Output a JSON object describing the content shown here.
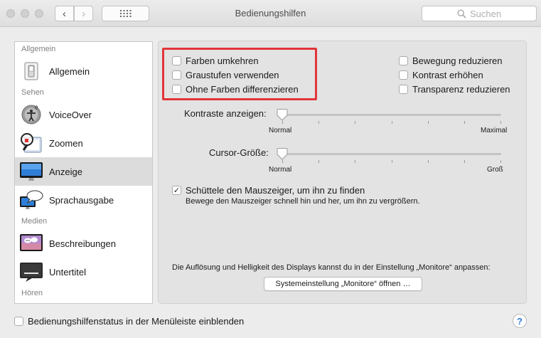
{
  "window": {
    "title": "Bedienungshilfen",
    "back_glyph": "‹",
    "forward_glyph": "›",
    "search_placeholder": "Suchen"
  },
  "sidebar": {
    "sections": [
      {
        "header": "Allgemein",
        "items": [
          {
            "label": "Allgemein",
            "icon": "switch-icon"
          }
        ]
      },
      {
        "header": "Sehen",
        "items": [
          {
            "label": "VoiceOver",
            "icon": "voiceover-icon"
          },
          {
            "label": "Zoomen",
            "icon": "zoom-icon"
          },
          {
            "label": "Anzeige",
            "icon": "display-icon",
            "selected": true
          },
          {
            "label": "Sprachausgabe",
            "icon": "speech-icon"
          }
        ]
      },
      {
        "header": "Medien",
        "items": [
          {
            "label": "Beschreibungen",
            "icon": "descriptions-icon"
          },
          {
            "label": "Untertitel",
            "icon": "captions-icon"
          }
        ]
      },
      {
        "header": "Hören",
        "items": []
      }
    ]
  },
  "display": {
    "checkboxes_left": [
      {
        "label": "Farben umkehren",
        "checked": false
      },
      {
        "label": "Graustufen verwenden",
        "checked": false
      },
      {
        "label": "Ohne Farben differenzieren",
        "checked": false
      }
    ],
    "checkboxes_right": [
      {
        "label": "Bewegung reduzieren",
        "checked": false
      },
      {
        "label": "Kontrast erhöhen",
        "checked": false
      },
      {
        "label": "Transparenz reduzieren",
        "checked": false
      }
    ],
    "contrast": {
      "label": "Kontraste anzeigen:",
      "min_label": "Normal",
      "max_label": "Maximal",
      "value": 0
    },
    "cursor": {
      "label": "Cursor-Größe:",
      "min_label": "Normal",
      "max_label": "Groß",
      "value": 0
    },
    "shake": {
      "label": "Schüttele den Mauszeiger, um ihn zu finden",
      "checked": true,
      "check_glyph": "✓",
      "description": "Bewege den Mauszeiger schnell hin und her, um ihn zu vergrößern."
    },
    "monitor_note": "Die Auflösung und Helligkeit des Displays kannst du in der Einstellung „Monitore“ anpassen:",
    "monitor_button": "Systemeinstellung „Monitore“ öffnen …"
  },
  "footer": {
    "menubar_checkbox": {
      "label": "Bedienungshilfenstatus in der Menüleiste einblenden",
      "checked": false
    },
    "help_label": "?"
  },
  "colors": {
    "highlight": "#e2353a",
    "selection": "#dcdcdc",
    "help_accent": "#2f7ad9"
  }
}
